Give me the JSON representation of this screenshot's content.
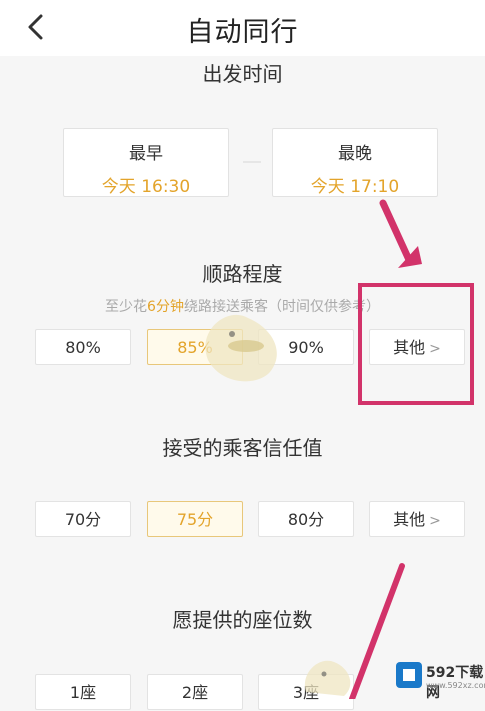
{
  "header": {
    "title": "自动同行",
    "back_icon": "chevron-left-icon"
  },
  "departure": {
    "title": "出发时间",
    "earliest_label": "最早",
    "earliest_value": "今天 16:30",
    "latest_label": "最晚",
    "latest_value": "今天 17:10"
  },
  "route": {
    "title": "顺路程度",
    "hint_prefix": "至少花",
    "hint_highlight": "6分钟",
    "hint_suffix": "绕路接送乘客（时间仅供参考）",
    "options": [
      "80%",
      "85%",
      "90%",
      "其他"
    ],
    "selected": "85%"
  },
  "trust": {
    "title": "接受的乘客信任值",
    "options": [
      "70分",
      "75分",
      "80分",
      "其他"
    ],
    "selected": "75分"
  },
  "seats": {
    "title": "愿提供的座位数",
    "options": [
      "1座",
      "2座",
      "3座"
    ]
  },
  "watermark": {
    "brand": "592下载网",
    "domain": "www.592xz.com"
  },
  "colors": {
    "accent": "#e3a42b",
    "annotation": "#d2336a"
  }
}
